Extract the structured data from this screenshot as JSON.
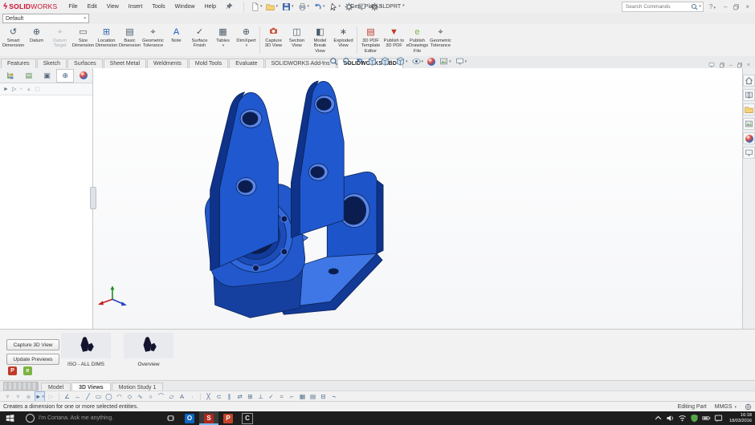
{
  "window": {
    "brand_solid": "SOLID",
    "brand_works": "WORKS",
    "title": "Gear Plate.SLDPRT *",
    "search_placeholder": "Search Commands",
    "help_label": "?"
  },
  "menus": [
    {
      "n": "menu-file",
      "label": "File"
    },
    {
      "n": "menu-edit",
      "label": "Edit"
    },
    {
      "n": "menu-view",
      "label": "View"
    },
    {
      "n": "menu-insert",
      "label": "Insert"
    },
    {
      "n": "menu-tools",
      "label": "Tools"
    },
    {
      "n": "menu-window",
      "label": "Window"
    },
    {
      "n": "menu-help",
      "label": "Help"
    }
  ],
  "quick_access": [
    {
      "n": "new-document-button",
      "sym": "page",
      "caret": true
    },
    {
      "n": "open-button",
      "sym": "folder",
      "caret": true
    },
    {
      "n": "save-button",
      "sym": "save",
      "caret": true
    },
    {
      "n": "print-button",
      "sym": "print",
      "caret": true
    },
    {
      "n": "undo-button",
      "sym": "undo",
      "caret": true
    },
    {
      "n": "select-button",
      "sym": "cursor",
      "caret": true,
      "boxed": true
    },
    {
      "n": "rebuild-button",
      "sym": "gear"
    },
    {
      "n": "file-properties-button",
      "sym": "monitor"
    },
    {
      "n": "options-button",
      "sym": "gear",
      "caret": true
    }
  ],
  "config": {
    "value": "Default"
  },
  "ribbon": [
    {
      "n": "smart-dimension-button",
      "label": "Smart Dimension",
      "glyph": "↺",
      "color": "#4a5a6a"
    },
    {
      "n": "datum-button",
      "label": "Datum",
      "glyph": "⊕",
      "color": "#4a5a6a"
    },
    {
      "n": "datum-target-button",
      "label": "Datum Target",
      "glyph": "⌖",
      "disabled": true
    },
    {
      "n": "size-dimension-button",
      "label": "Size Dimension",
      "glyph": "▭",
      "color": "#4a5a6a"
    },
    {
      "n": "location-dimension-button",
      "label": "Location Dimension",
      "glyph": "⊞",
      "color": "#3a6ab0"
    },
    {
      "n": "basic-dimension-button",
      "label": "Basic Dimension",
      "glyph": "▤",
      "color": "#4a5a6a"
    },
    {
      "n": "geometric-tolerance-button",
      "label": "Geometric Tolerance",
      "glyph": "⌖",
      "color": "#4a5a6a"
    },
    {
      "n": "note-button",
      "label": "Note",
      "glyph": "A",
      "color": "#1a56c8"
    },
    {
      "n": "surface-finish-button",
      "label": "Surface Finish",
      "glyph": "✓",
      "color": "#4a5a6a"
    },
    {
      "n": "tables-button",
      "label": "Tables",
      "glyph": "▦",
      "color": "#4a5a6a",
      "caret": true
    },
    {
      "n": "dimxpert-button",
      "label": "DimXpert",
      "glyph": "⊕",
      "color": "#4a5a6a",
      "caret": true
    },
    {
      "sep": true
    },
    {
      "n": "capture-3d-view-button",
      "label": "Capture 3D View",
      "sym": "camera"
    },
    {
      "n": "section-view-button",
      "label": "Section View",
      "glyph": "◫",
      "color": "#4a5a6a"
    },
    {
      "n": "model-break-view-button",
      "label": "Model Break View",
      "glyph": "◧",
      "color": "#4a5a6a"
    },
    {
      "n": "exploded-view-button",
      "label": "Exploded View",
      "glyph": "∗",
      "color": "#4a5a6a"
    },
    {
      "sep": true
    },
    {
      "n": "3d-pdf-template-editor-button",
      "label": "3D PDF Template Editor",
      "glyph": "▤",
      "color": "#c0392b"
    },
    {
      "n": "publish-to-3d-pdf-button",
      "label": "Publish to 3D PDF",
      "glyph": "▼",
      "color": "#c0392b"
    },
    {
      "n": "publish-edrawings-file-button",
      "label": "Publish eDrawings File",
      "glyph": "e",
      "color": "#7cb342"
    },
    {
      "n": "geometric-tolerance-2-button",
      "label": "Geometric Tolerance",
      "glyph": "⌖",
      "color": "#4a5a6a"
    }
  ],
  "command_tabs": [
    {
      "n": "tab-features",
      "label": "Features"
    },
    {
      "n": "tab-sketch",
      "label": "Sketch"
    },
    {
      "n": "tab-surfaces",
      "label": "Surfaces"
    },
    {
      "n": "tab-sheet-metal",
      "label": "Sheet Metal"
    },
    {
      "n": "tab-weldments",
      "label": "Weldments"
    },
    {
      "n": "tab-mold-tools",
      "label": "Mold Tools"
    },
    {
      "n": "tab-evaluate",
      "label": "Evaluate"
    },
    {
      "n": "tab-solidworks-add-ins",
      "label": "SOLIDWORKS Add-Ins"
    },
    {
      "n": "tab-solidworks-mbd",
      "label": "SOLIDWORKS MBD",
      "active": true
    }
  ],
  "headsup": [
    {
      "n": "expand-arrow-icon",
      "glyph": "▸",
      "color": "#9aa4ad"
    },
    {
      "n": "zoom-to-fit-icon",
      "sym": "mag"
    },
    {
      "n": "zoom-to-area-icon",
      "sym": "mag"
    },
    {
      "n": "previous-view-icon",
      "sym": "undo"
    },
    {
      "n": "section-view-icon",
      "sym": "cube"
    },
    {
      "n": "view-orientation-icon",
      "sym": "cube",
      "caret": true
    },
    {
      "n": "display-style-icon",
      "sym": "cube",
      "caret": true
    },
    {
      "n": "hide-show-items-icon",
      "sym": "eye",
      "caret": true
    },
    {
      "n": "edit-appearance-icon",
      "ball": true
    },
    {
      "n": "apply-scene-icon",
      "sym": "image",
      "caret": true
    },
    {
      "n": "view-settings-icon",
      "sym": "monitor",
      "caret": true
    }
  ],
  "left_tabs": [
    {
      "n": "featuremanager-tab",
      "sym": "tree"
    },
    {
      "n": "propertymanager-tab",
      "glyph": "▤",
      "color": "#5a8a4a"
    },
    {
      "n": "configurationmanager-tab",
      "glyph": "▣",
      "color": "#5a6a7a"
    },
    {
      "n": "dimxpertmanager-tab",
      "glyph": "⊕",
      "color": "#3a5a8a",
      "active": true
    },
    {
      "n": "displaymanager-tab",
      "ball": true
    }
  ],
  "left_filters": [
    {
      "n": "filter-arrow-icon",
      "g": "►"
    },
    {
      "n": "filter-flag-icon",
      "g": "▷"
    },
    {
      "n": "filter-add-icon",
      "g": "+",
      "dim": true
    },
    {
      "n": "filter-expand-icon",
      "g": "▲",
      "dim": true
    },
    {
      "n": "filter-box-icon",
      "g": "▢",
      "dim": true
    }
  ],
  "right_pane": [
    {
      "n": "task-pane-home-tab",
      "sym": "home"
    },
    {
      "n": "design-library-tab",
      "sym": "book"
    },
    {
      "n": "file-explorer-tab",
      "sym": "folder"
    },
    {
      "n": "view-palette-tab",
      "sym": "image"
    },
    {
      "n": "appearances-tab",
      "ball": true
    },
    {
      "n": "custom-properties-tab",
      "sym": "monitor"
    }
  ],
  "bottom_panel": {
    "capture_label": "Capture 3D View",
    "update_label": "Update Previews",
    "views": [
      {
        "n": "view-thumbnail-iso",
        "label": "ISO - ALL DIMS"
      },
      {
        "n": "view-thumbnail-overview",
        "label": "Overview",
        "variant": true
      }
    ],
    "publish": [
      {
        "n": "publish-3d-pdf-icon",
        "letter": "P",
        "bg": "#c0392b"
      },
      {
        "n": "publish-edrawings-icon",
        "letter": "e",
        "bg": "#7cb342"
      }
    ]
  },
  "bottom_tabs": [
    {
      "n": "tab-model",
      "label": "Model"
    },
    {
      "n": "tab-3d-views",
      "label": "3D Views",
      "active": true
    },
    {
      "n": "tab-motion-study-1",
      "label": "Motion Study 1"
    }
  ],
  "sketch_tools": [
    {
      "n": "filter-vertices-tool",
      "g": "▼",
      "dim": true
    },
    {
      "n": "filter-edges-tool",
      "g": "▼",
      "dim": true
    },
    {
      "n": "filter-faces-tool",
      "g": "◆",
      "dim": true
    },
    {
      "n": "select-arrow-tool",
      "g": "►",
      "pressed": true,
      "caret": true
    },
    {
      "n": "lasso-select-tool",
      "g": "▷",
      "dim": true
    },
    {
      "sep": true
    },
    {
      "n": "sketch-tool",
      "g": "∠"
    },
    {
      "n": "smart-dimension-tool",
      "g": "↔"
    },
    {
      "n": "line-tool",
      "g": "╱"
    },
    {
      "n": "rectangle-tool",
      "g": "▭"
    },
    {
      "n": "circle-tool",
      "g": "◯"
    },
    {
      "n": "arc-tool",
      "g": "◠"
    },
    {
      "n": "polygon-tool",
      "g": "◇"
    },
    {
      "n": "spline-tool",
      "g": "∿"
    },
    {
      "n": "ellipse-tool",
      "g": "○"
    },
    {
      "n": "fillet-tool",
      "g": "⌒"
    },
    {
      "n": "plane-tool",
      "g": "▱"
    },
    {
      "n": "text-tool",
      "g": "A"
    },
    {
      "n": "point-tool",
      "g": "·"
    },
    {
      "sep": true
    },
    {
      "n": "trim-entities-tool",
      "g": "╳"
    },
    {
      "n": "convert-entities-tool",
      "g": "⊂"
    },
    {
      "n": "offset-entities-tool",
      "g": "∥"
    },
    {
      "n": "mirror-entities-tool",
      "g": "⇄"
    },
    {
      "n": "linear-pattern-tool",
      "g": "⊞"
    },
    {
      "n": "move-entities-tool",
      "g": "⊥"
    },
    {
      "n": "display-relations-tool",
      "g": "✓"
    },
    {
      "n": "repair-sketch-tool",
      "g": "≈"
    },
    {
      "n": "instant-2d-tool",
      "g": "⌐"
    },
    {
      "n": "shaded-contours-tool",
      "g": "▦"
    },
    {
      "n": "sketch-picture-tool",
      "g": "▤"
    },
    {
      "n": "grid-settings-tool",
      "g": "⊟"
    },
    {
      "n": "more-tools-button",
      "g": "¬"
    }
  ],
  "status": {
    "message": "Creates a dimension for one or more selected entities.",
    "mode": "Editing Part",
    "units": "MMGS"
  },
  "taskbar": {
    "cortana_text": "I'm Cortana. Ask me anything.",
    "apps": [
      {
        "n": "taskbar-outlook-icon",
        "letter": "O",
        "bg": "#0a66c2",
        "fg": "#ffffff"
      },
      {
        "n": "taskbar-solidworks-icon",
        "letter": "S",
        "bg": "#b0271b",
        "fg": "#ffffff",
        "active": true
      },
      {
        "n": "taskbar-powerpoint-icon",
        "letter": "P",
        "bg": "#c4432b",
        "fg": "#ffffff"
      },
      {
        "n": "taskbar-app-c-icon",
        "letter": "C",
        "fg": "#e8e8e8",
        "boxed": true
      }
    ],
    "tray": [
      {
        "n": "chevron-up-icon",
        "sym": "chev"
      },
      {
        "n": "volume-icon",
        "sym": "speaker"
      },
      {
        "n": "network-icon",
        "sym": "wifi"
      },
      {
        "n": "antivirus-icon",
        "sym": "shield"
      },
      {
        "n": "battery-icon",
        "sym": "battery"
      },
      {
        "n": "action-center-icon",
        "sym": "msg"
      }
    ],
    "time": "16:18",
    "date": "18/03/2016"
  },
  "colors": {
    "part_blue": "#2058cf",
    "part_dark": "#0f338a",
    "part_hole": "#0a1d4e",
    "ribbon_bg": "#f1f1f1",
    "taskbar_bg": "#1d1d1d",
    "brand_red": "#c8102e"
  }
}
